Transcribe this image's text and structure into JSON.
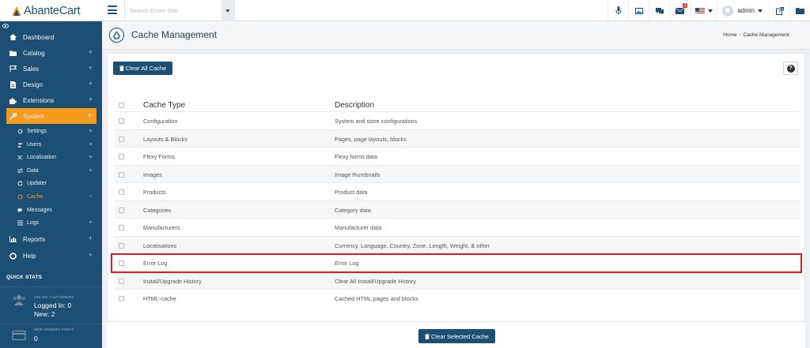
{
  "app": {
    "name": "AbanteCart"
  },
  "topbar": {
    "search_placeholder": "Search Entire Site",
    "messages_badge": "",
    "mail_badge": "1",
    "user": "admin"
  },
  "sidebar": {
    "items": [
      {
        "label": "Dashboard",
        "icon": "home-icon",
        "expandable": false
      },
      {
        "label": "Catalog",
        "icon": "folder-icon",
        "expandable": true
      },
      {
        "label": "Sales",
        "icon": "flag-icon",
        "expandable": true
      },
      {
        "label": "Design",
        "icon": "file-icon",
        "expandable": true
      },
      {
        "label": "Extensions",
        "icon": "puzzle-icon",
        "expandable": true
      },
      {
        "label": "System",
        "icon": "wrench-icon",
        "expandable": true,
        "active": true
      }
    ],
    "system_children": [
      {
        "label": "Settings",
        "icon": "gears-icon",
        "expandable": true
      },
      {
        "label": "Users",
        "icon": "users-icon",
        "expandable": true
      },
      {
        "label": "Localization",
        "icon": "random-icon",
        "expandable": true
      },
      {
        "label": "Data",
        "icon": "exchange-icon",
        "expandable": true
      },
      {
        "label": "Updater",
        "icon": "refresh-icon",
        "expandable": false
      },
      {
        "label": "Cache",
        "icon": "recycle-icon",
        "expandable": false,
        "current": true,
        "toggle": "−"
      },
      {
        "label": "Messages",
        "icon": "comments-icon",
        "expandable": false
      },
      {
        "label": "Logs",
        "icon": "list-icon",
        "expandable": true
      }
    ],
    "bottom_items": [
      {
        "label": "Reports",
        "icon": "chart-icon",
        "expandable": true
      },
      {
        "label": "Help",
        "icon": "lifebuoy-icon",
        "expandable": true
      }
    ],
    "plus_glyph": "+",
    "quick_stats": {
      "title": "QUICK STATS",
      "online_caption": "ONLINE CUSTOMERS",
      "logged_in": "Logged In: 0",
      "new": "New: 2",
      "orders_caption": "NEW ORDERS TODAY",
      "orders_value": "0"
    }
  },
  "page": {
    "title": "Cache Management",
    "breadcrumb": [
      "Home",
      "Cache Management"
    ],
    "clear_all_label": "Clear All Cache",
    "clear_selected_label": "Clear Selected Cache",
    "help_glyph": "?"
  },
  "table": {
    "columns": [
      "Cache Type",
      "Description"
    ],
    "rows": [
      {
        "type": "Configuration",
        "description": "System and store configurations"
      },
      {
        "type": "Layouts & Blocks",
        "description": "Pages, page layouts, blocks"
      },
      {
        "type": "Flexy Forms",
        "description": "Flexy forms data"
      },
      {
        "type": "Images",
        "description": "Image thumbnails"
      },
      {
        "type": "Products",
        "description": "Product data"
      },
      {
        "type": "Categories",
        "description": "Category data"
      },
      {
        "type": "Manufacturers",
        "description": "Manufacturer data"
      },
      {
        "type": "Localisations",
        "description": "Currency, Language, Country, Zone, Length, Weight, & other"
      },
      {
        "type": "Error Log",
        "description": "Error Log",
        "highlighted": true
      },
      {
        "type": "Install/Upgrade History",
        "description": "Clear All Install/Upgrade History"
      },
      {
        "type": "HTML-cache",
        "description": "Cached HTML pages and blocks"
      }
    ]
  },
  "colors": {
    "brand": "#1d4f74",
    "accent": "#f59a1d",
    "highlight": "#e0191f"
  }
}
